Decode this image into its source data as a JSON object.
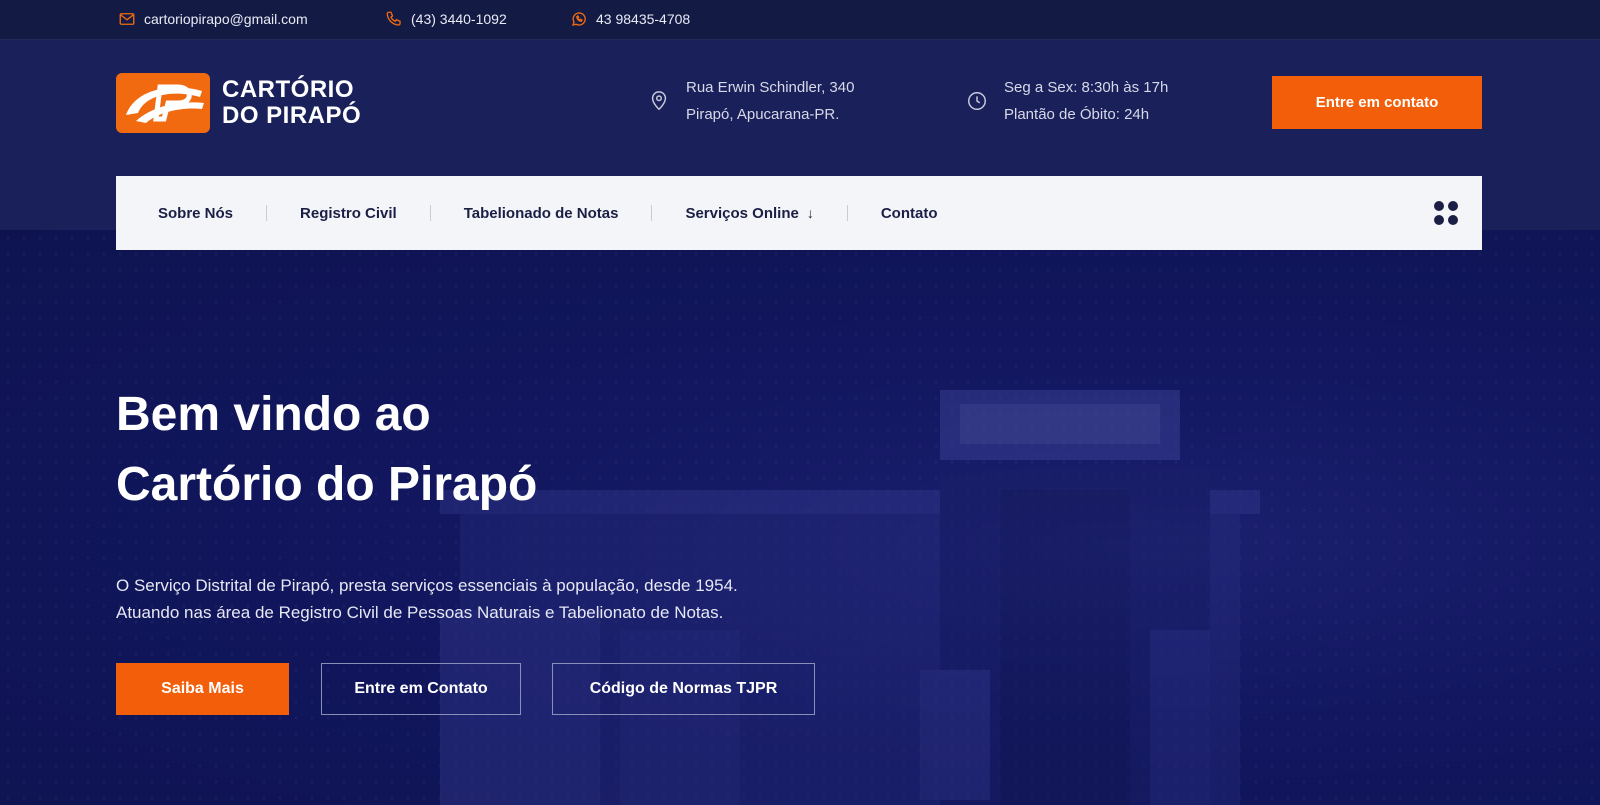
{
  "topbar": {
    "email": "cartoriopirapo@gmail.com",
    "phone": "(43) 3440-1092",
    "whatsapp": "43 98435-4708",
    "icons": {
      "email": "mail-icon",
      "phone": "phone-icon",
      "whatsapp": "whatsapp-icon"
    }
  },
  "brand": {
    "line1": "CARTÓRIO",
    "line2": "DO PIRAPÓ",
    "accent": "#f25e0a",
    "navy": "#0f1452"
  },
  "header": {
    "address_line1": "Rua Erwin Schindler, 340",
    "address_line2": "Pirapó, Apucarana-PR.",
    "hours_line1": "Seg a Sex: 8:30h às 17h",
    "hours_line2": "Plantão de Óbito: 24h",
    "cta_label": "Entre em contato"
  },
  "nav": {
    "items": [
      "Sobre Nós",
      "Registro Civil",
      "Tabelionado de Notas",
      "Serviços Online",
      "Contato"
    ],
    "dropdown_index": 3
  },
  "hero": {
    "title_line1": "Bem vindo ao",
    "title_line2": "Cartório do Pirapó",
    "desc_line1": "O Serviço Distrital de Pirapó, presta serviços essenciais à população, desde 1954.",
    "desc_line2": "Atuando nas área de Registro Civil de Pessoas Naturais e Tabelionato de Notas.",
    "buttons": [
      "Saiba Mais",
      "Entre em Contato",
      "Código de Normas TJPR"
    ]
  }
}
